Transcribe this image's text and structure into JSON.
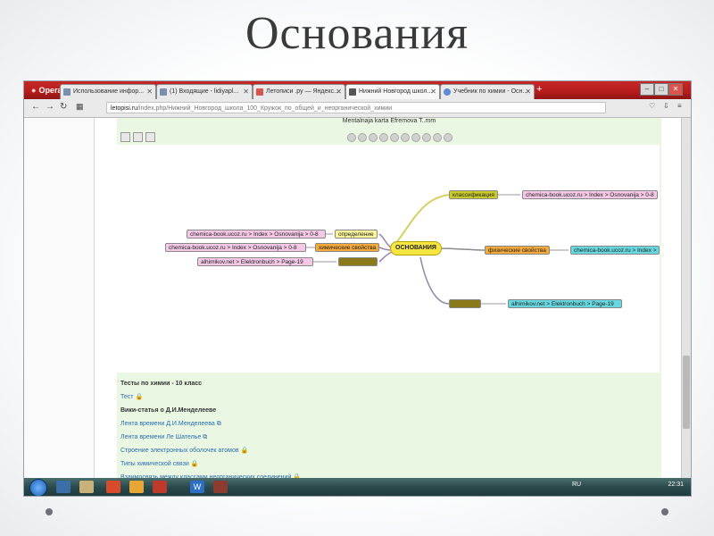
{
  "slide": {
    "title": "Основания"
  },
  "browser": {
    "opera_label": "Opera",
    "tabs": [
      {
        "label": "Использование инфор...",
        "active": false
      },
      {
        "label": "(1) Входящие - lidiyapl...",
        "active": false
      },
      {
        "label": "Летописи .ру — Яндекс...",
        "active": false
      },
      {
        "label": "Нижний Новгород школ...",
        "active": true
      },
      {
        "label": "Учебник по химии - Осн...",
        "active": false
      }
    ],
    "new_tab": "+",
    "url_domain": "letopisi.ru",
    "url_path": "/index.php/Нижний_Новгород_школа_100_Кружок_по_общей_и_неорганической_химии"
  },
  "mindmap": {
    "header": "Mentalnaja karta Efremova T..mm",
    "center": "ОСНОВАНИЯ",
    "nodes": {
      "opredelenie": "определение",
      "himicheskie": "химические свойства",
      "left_third": "",
      "klassifikaciya": "классификация",
      "fizicheskie": "физические свойства",
      "bottom_right": "",
      "link_opredelenie": "chemica-book.ucoz.ru > Index > Osnovanija > 0-8",
      "link_himicheskie": "chemica-book.ucoz.ru > Index > Osnovanija > 0-8",
      "link_left_third": "alhimikov.net > Elektronbuch > Page-19",
      "link_klassifikaciya": "chemica-book.ucoz.ru > Index > Osnovanija > 0-8",
      "link_fizicheskie": "chemica-book.ucoz.ru > Index >",
      "link_bottom_right": "alhimikov.net > Elektronbuch > Page-19"
    }
  },
  "below_links": [
    {
      "text": "Тесты по химии - 10 класс",
      "style": "bold",
      "lock": false
    },
    {
      "text": "Тест",
      "style": "link",
      "lock": true
    },
    {
      "text": "Вики-статья о Д.И.Менделееве",
      "style": "bold",
      "lock": false
    },
    {
      "text": "Лента времени Д.И.Менделеева",
      "style": "link",
      "lock": false
    },
    {
      "text": "Лента времени Ле Шателье",
      "style": "link",
      "lock": false
    },
    {
      "text": "Строение электронных оболочек атомов",
      "style": "link",
      "lock": true
    },
    {
      "text": "Типы химической связи",
      "style": "link",
      "lock": true
    },
    {
      "text": "Взаимосвязь между классами неорганических соединений",
      "style": "link",
      "lock": true
    }
  ],
  "taskbar": {
    "lang": "RU",
    "clock": "22:31"
  },
  "colors": {
    "tabbar": "#b71c1c",
    "content_bg": "#eaf7e2",
    "center_node": "#f5e642",
    "link_pink": "#f5c8e6",
    "link_cyan": "#67d8e0",
    "orange_node": "#f4a93a",
    "olive_node": "#8a7a1a"
  }
}
